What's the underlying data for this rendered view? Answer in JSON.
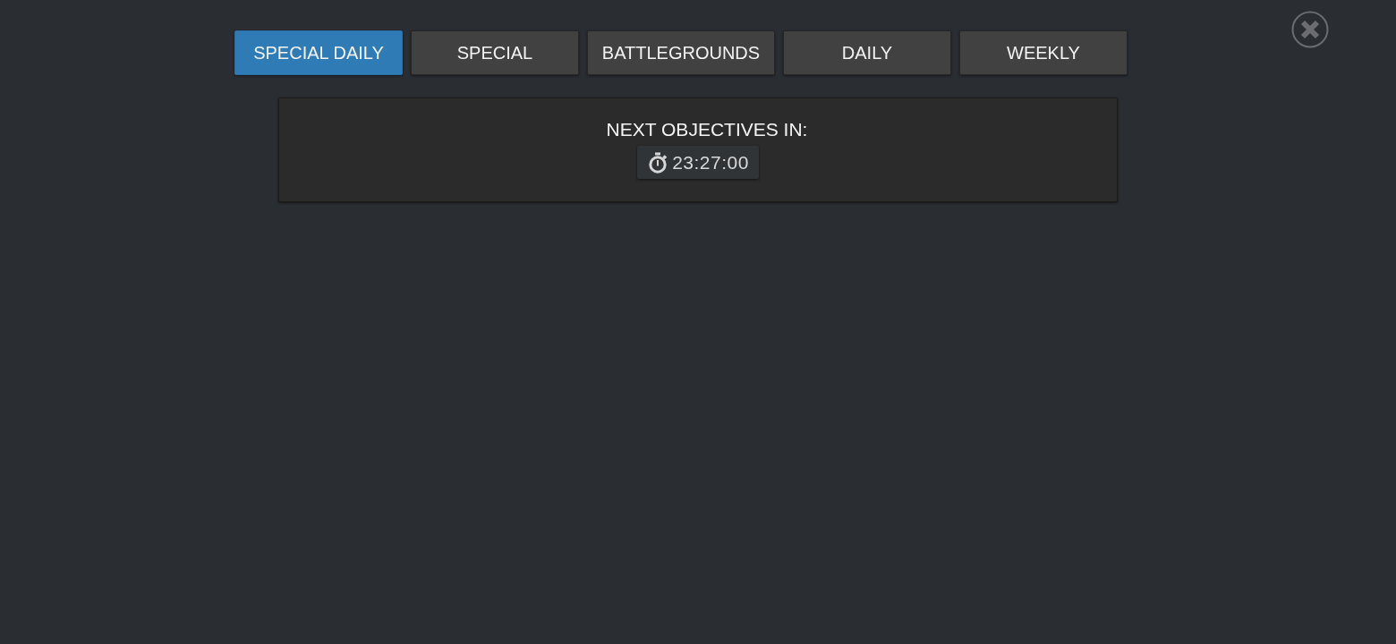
{
  "tabs": [
    {
      "label": "SPECIAL DAILY",
      "selected": true
    },
    {
      "label": "SPECIAL",
      "selected": false
    },
    {
      "label": "BATTLEGROUNDS",
      "selected": false
    },
    {
      "label": "DAILY",
      "selected": false
    },
    {
      "label": "WEEKLY",
      "selected": false
    }
  ],
  "objectives_panel": {
    "heading": "NEXT OBJECTIVES IN:",
    "timer": "23:27:00"
  }
}
